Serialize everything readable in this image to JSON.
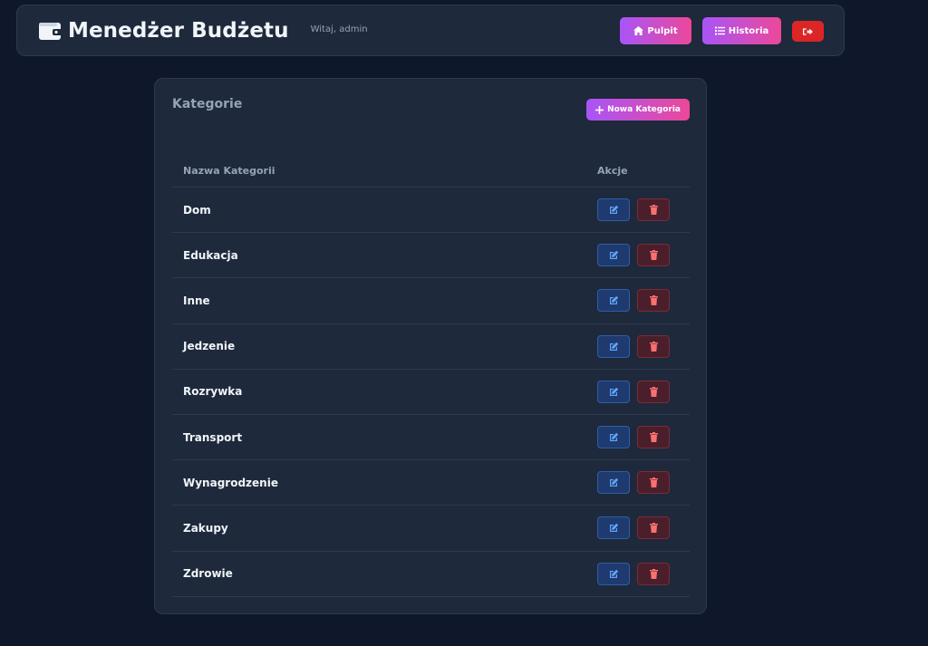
{
  "header": {
    "title": "Menedżer Budżetu",
    "welcome": "Witaj, admin",
    "buttons": {
      "dashboard": "Pulpit",
      "history": "Historia"
    }
  },
  "categories_card": {
    "title": "Kategorie",
    "new_button": "Nowa Kategoria",
    "columns": [
      "Nazwa Kategorii",
      "Akcje"
    ],
    "rows": [
      "Dom",
      "Edukacja",
      "Inne",
      "Jedzenie",
      "Rozrywka",
      "Transport",
      "Wynagrodzenie",
      "Zakupy",
      "Zdrowie"
    ]
  },
  "colors": {
    "background": "#0f172a",
    "panel": "#1e293b",
    "accent_gradient_start": "#a855f7",
    "accent_gradient_end": "#ec4899",
    "danger": "#dc2626",
    "edit_icon": "#60a5fa",
    "delete_icon": "#f87171"
  },
  "icons": {
    "brand": "wallet-icon",
    "dashboard": "home-icon",
    "history": "list-icon",
    "logout": "logout-icon",
    "add": "plus-icon",
    "edit": "edit-icon",
    "delete": "trash-icon"
  }
}
